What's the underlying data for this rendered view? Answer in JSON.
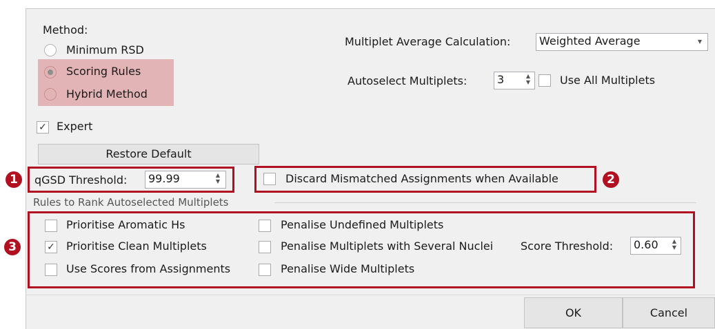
{
  "method": {
    "label": "Method:",
    "options": [
      "Minimum RSD",
      "Scoring Rules",
      "Hybrid Method"
    ],
    "selected": "Scoring Rules"
  },
  "multiplet_avg": {
    "label": "Multiplet Average Calculation:",
    "value": "Weighted Average"
  },
  "autoselect": {
    "label": "Autoselect Multiplets:",
    "value": "3",
    "use_all_label": "Use All Multiplets",
    "use_all_checked": false
  },
  "expert": {
    "label": "Expert",
    "checked": true,
    "check_mark": "✓"
  },
  "restore_label": "Restore Default",
  "qgsd": {
    "label": "qGSD Threshold:",
    "value": "99.99"
  },
  "discard_label": "Discard Mismatched Assignments when Available",
  "rules": {
    "group_label": "Rules to Rank Autoselected Multiplets",
    "col1": [
      "Prioritise Aromatic Hs",
      "Prioritise Clean Multiplets",
      "Use Scores from Assignments"
    ],
    "col2": [
      "Penalise Undefined Multiplets",
      "Penalise Multiplets with Several Nuclei",
      "Penalise Wide Multiplets"
    ],
    "checked": "Prioritise Clean Multiplets",
    "score_label": "Score Threshold:",
    "score_value": "0.60"
  },
  "buttons": {
    "ok": "OK",
    "cancel": "Cancel"
  },
  "badges": [
    "1",
    "2",
    "3"
  ],
  "icons": {
    "spin_up": "▲",
    "spin_down": "▼",
    "dropdown": "▾"
  },
  "colors": {
    "annotation_red": "#b0101f",
    "highlight": "#e2b4b6",
    "panel": "#f0f0f0"
  }
}
